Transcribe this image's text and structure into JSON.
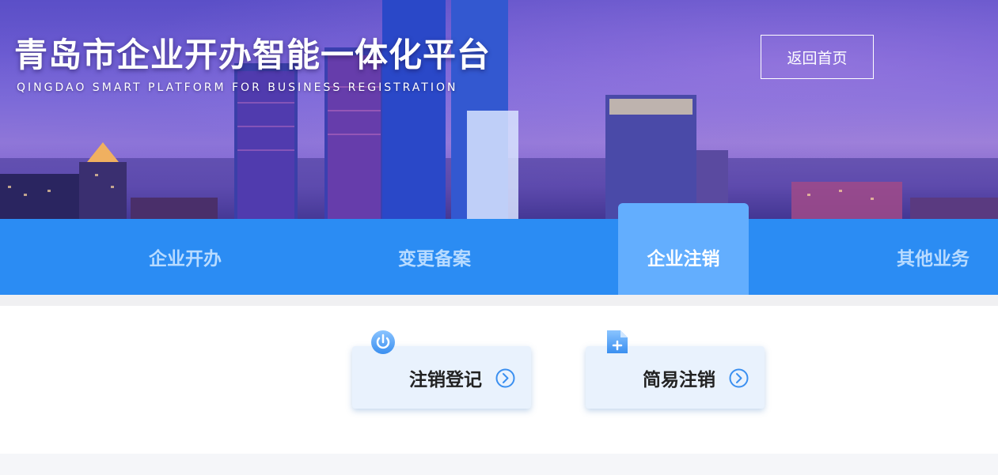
{
  "header": {
    "title": "青岛市企业开办智能一体化平台",
    "subtitle": "QINGDAO SMART PLATFORM FOR BUSINESS REGISTRATION",
    "home_button": "返回首页"
  },
  "nav": {
    "tabs": [
      {
        "label": "企业开办",
        "active": false
      },
      {
        "label": "变更备案",
        "active": false
      },
      {
        "label": "企业注销",
        "active": true
      },
      {
        "label": "其他业务",
        "active": false
      }
    ]
  },
  "services": [
    {
      "label": "注销登记",
      "icon": "power-icon"
    },
    {
      "label": "简易注销",
      "icon": "add-document-icon"
    }
  ],
  "colors": {
    "nav_bg": "#2b8cf3",
    "nav_active_bg": "#63aefe",
    "card_bg": "#e9f2fd",
    "accent": "#3a8ff0"
  }
}
